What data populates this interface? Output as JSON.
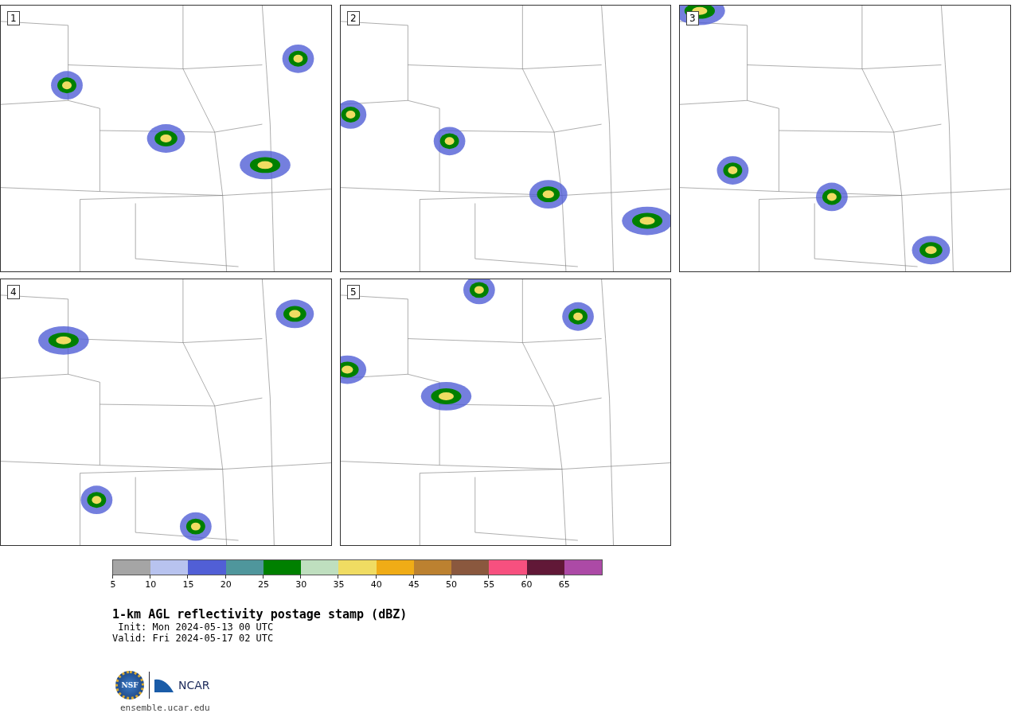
{
  "panels": [
    {
      "label": "1"
    },
    {
      "label": "2"
    },
    {
      "label": "3"
    },
    {
      "label": "4"
    },
    {
      "label": "5"
    }
  ],
  "colorbar": [
    {
      "color": "#a5a5a5",
      "label": "5"
    },
    {
      "color": "#b8c3ef",
      "label": "10"
    },
    {
      "color": "#515fd6",
      "label": "15"
    },
    {
      "color": "#4f969c",
      "label": "20"
    },
    {
      "color": "#008000",
      "label": "25"
    },
    {
      "color": "#bfdfbf",
      "label": "30"
    },
    {
      "color": "#f0dc62",
      "label": "35"
    },
    {
      "color": "#f0ac16",
      "label": "40"
    },
    {
      "color": "#bc8130",
      "label": "45"
    },
    {
      "color": "#8a583e",
      "label": "50"
    },
    {
      "color": "#f7507f",
      "label": "55"
    },
    {
      "color": "#611837",
      "label": "60"
    },
    {
      "color": "#ac4aa6",
      "label": "65"
    }
  ],
  "title": "1-km AGL reflectivity postage stamp (dBZ)",
  "init": " Init: Mon 2024-05-13 00 UTC",
  "valid": "Valid: Fri 2024-05-17 02 UTC",
  "logos": {
    "nsf": "NSF",
    "ncar": "NCAR"
  },
  "url": "ensemble.ucar.edu"
}
